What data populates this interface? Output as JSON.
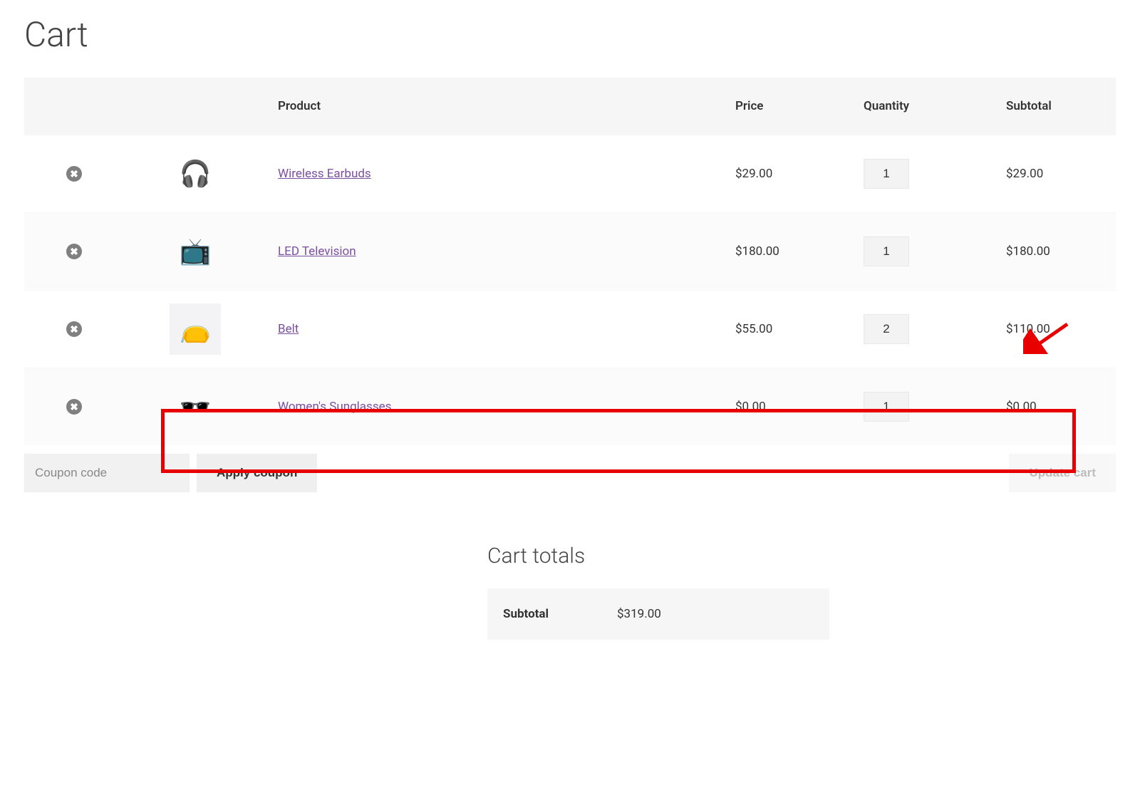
{
  "page": {
    "title": "Cart"
  },
  "table": {
    "headers": {
      "product": "Product",
      "price": "Price",
      "quantity": "Quantity",
      "subtotal": "Subtotal"
    }
  },
  "items": [
    {
      "icon": "🎧",
      "thumb_class": "thumb-plain",
      "name": "Wireless Earbuds",
      "price": "$29.00",
      "quantity": "1",
      "subtotal": "$29.00"
    },
    {
      "icon": "📺",
      "thumb_class": "thumb-plain",
      "name": "LED Television",
      "price": "$180.00",
      "quantity": "1",
      "subtotal": "$180.00"
    },
    {
      "icon": "👝",
      "thumb_class": "",
      "name": "Belt",
      "price": "$55.00",
      "quantity": "2",
      "subtotal": "$110.00"
    },
    {
      "icon": "🕶️",
      "thumb_class": "thumb-plain",
      "name": "Women's Sunglasses",
      "price": "$0.00",
      "quantity": "1",
      "subtotal": "$0.00"
    }
  ],
  "coupon": {
    "placeholder": "Coupon code",
    "apply_label": "Apply coupon"
  },
  "update_cart_label": "Update cart",
  "totals": {
    "title": "Cart totals",
    "rows": [
      {
        "label": "Subtotal",
        "value": "$319.00"
      }
    ]
  },
  "annotations": {
    "highlighted_row_index": 3,
    "arrow_target": "items.2.subtotal"
  }
}
